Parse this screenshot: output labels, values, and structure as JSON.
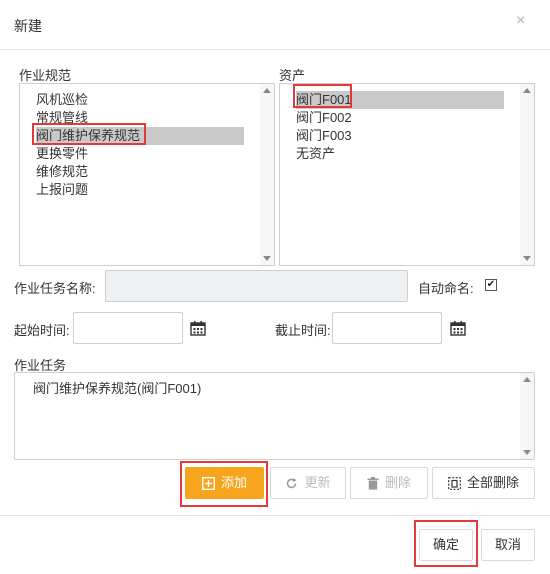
{
  "dialog": {
    "title": "新建",
    "close_symbol": "×"
  },
  "work_spec": {
    "label": "作业规范",
    "items": [
      "风机巡检",
      "常规管线",
      "阀门维护保养规范",
      "更换零件",
      "维修规范",
      "上报问题"
    ],
    "selected_index": 2
  },
  "assets": {
    "label": "资产",
    "items": [
      "阀门F001",
      "阀门F002",
      "阀门F003",
      "无资产"
    ],
    "selected_index": 0
  },
  "task_name": {
    "label": "作业任务名称:",
    "value": ""
  },
  "auto_name": {
    "label": "自动命名:",
    "checked": true,
    "check_mark": "✔"
  },
  "start_time": {
    "label": "起始时间:",
    "value": ""
  },
  "end_time": {
    "label": "截止时间:",
    "value": ""
  },
  "tasks": {
    "label": "作业任务",
    "items": [
      "阀门维护保养规范(阀门F001)"
    ]
  },
  "actions": {
    "add": "添加",
    "update": "更新",
    "delete": "删除",
    "delete_all": "全部删除"
  },
  "footer": {
    "confirm": "确定",
    "cancel": "取消"
  },
  "colors": {
    "primary": "#f7a51c",
    "highlight": "#e23a3a",
    "selected_bg": "#c9c9c9"
  }
}
